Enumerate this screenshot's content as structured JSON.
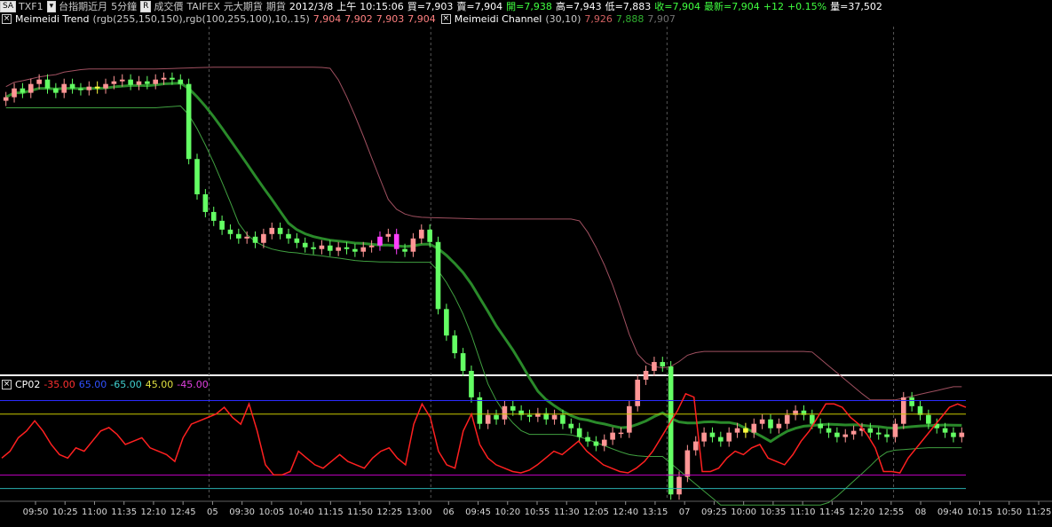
{
  "header": {
    "symbol_button": "SA",
    "symbol": "TXF1",
    "product": "台指期近月",
    "interval": "5分鐘",
    "r_button": "R",
    "price_type": "成交價",
    "exchange": "TAIFEX",
    "broker": "元大期貨",
    "market": "期貨",
    "date": "2012/3/8",
    "ampm": "上午",
    "time": "10:15:06",
    "bid": "買=7,903",
    "ask": "賣=7,904",
    "open": "開=7,938",
    "high": "高=7,943",
    "low": "低=7,883",
    "close": "收=7,904",
    "last": "最新=7,904",
    "change": "+12",
    "change_pct": "+0.15%",
    "volume": "量=37,502"
  },
  "indicator_line": {
    "trend_name": "Meimeidi Trend",
    "trend_params": "(rgb(255,150,150),rgb(100,255,100),10,.15)",
    "trend_values": [
      "7,904",
      "7,902",
      "7,903",
      "7,904"
    ],
    "channel_name": "Meimeidi Channel",
    "channel_params": "(30,10)",
    "channel_values": [
      "7,926",
      "7,888",
      "7,907"
    ]
  },
  "oscillator_header": {
    "name": "CP02",
    "levels": [
      "-35.00",
      "65.00",
      "-65.00",
      "45.00",
      "-45.00"
    ]
  },
  "colors": {
    "up": "#ff9696",
    "down": "#64ff64",
    "level_blue": "#2b2bff",
    "level_yellow": "#c8c800",
    "level_magenta": "#c000c0",
    "level_teal": "#2ab0b0",
    "osc_line": "#ff2020",
    "highlight_yellow": "#ffff40",
    "highlight_magenta": "#ff40ff"
  },
  "chart_data": {
    "type": "candlestick",
    "price_panel": {
      "ylim": [
        7700,
        8090
      ],
      "closes": [
        8010,
        8020,
        8015,
        8025,
        8030,
        8020,
        8015,
        8025,
        8020,
        8018,
        8022,
        8020,
        8025,
        8028,
        8030,
        8024,
        8028,
        8025,
        8030,
        8032,
        8030,
        8025,
        7940,
        7900,
        7880,
        7870,
        7860,
        7855,
        7850,
        7852,
        7845,
        7855,
        7862,
        7855,
        7850,
        7845,
        7840,
        7838,
        7842,
        7836,
        7840,
        7838,
        7835,
        7840,
        7842,
        7852,
        7855,
        7838,
        7835,
        7850,
        7860,
        7846,
        7770,
        7740,
        7720,
        7700,
        7670,
        7640,
        7650,
        7645,
        7660,
        7655,
        7650,
        7648,
        7652,
        7645,
        7650,
        7640,
        7635,
        7625,
        7620,
        7615,
        7622,
        7630,
        7630,
        7660,
        7690,
        7700,
        7710,
        7705,
        7560,
        7580,
        7610,
        7620,
        7630,
        7625,
        7620,
        7630,
        7635,
        7630,
        7640,
        7645,
        7635,
        7640,
        7650,
        7655,
        7650,
        7640,
        7635,
        7630,
        7625,
        7628,
        7632,
        7635,
        7630,
        7628,
        7625,
        7640,
        7670,
        7660,
        7650,
        7640,
        7635,
        7630,
        7625,
        7630
      ],
      "channel_upper_end": 7926,
      "channel_lower_end": 7888,
      "channel_mid_end": 7907
    },
    "oscillator_panel": {
      "name": "CP02",
      "ylim": [
        -80,
        80
      ],
      "levels": [
        65,
        45,
        -45,
        -65
      ],
      "values": [
        -20,
        -10,
        10,
        20,
        35,
        20,
        0,
        -15,
        -20,
        -5,
        -10,
        5,
        20,
        25,
        15,
        0,
        5,
        10,
        -5,
        -10,
        -15,
        -25,
        10,
        30,
        35,
        40,
        45,
        55,
        40,
        30,
        60,
        20,
        -30,
        -45,
        -45,
        -40,
        -10,
        -20,
        -30,
        -35,
        -25,
        -15,
        -25,
        -30,
        -35,
        -20,
        -10,
        -5,
        -20,
        -30,
        30,
        60,
        40,
        -10,
        -30,
        -35,
        20,
        45,
        0,
        -20,
        -30,
        -35,
        -40,
        -42,
        -38,
        -30,
        -20,
        -10,
        -15,
        -5,
        5,
        -10,
        -20,
        -30,
        -35,
        -40,
        -42,
        -35,
        -25,
        -10,
        10,
        30,
        50,
        75,
        70,
        -40,
        -40,
        -35,
        -20,
        -10,
        -15,
        -5,
        0,
        -20,
        -25,
        -30,
        -15,
        5,
        20,
        40,
        60,
        60,
        55,
        40,
        30,
        15,
        -5,
        -40,
        -40,
        -42,
        -20,
        -5,
        10,
        25,
        40,
        55,
        60,
        55
      ],
      "last_value": -35.0
    },
    "x_ticks": [
      "09:50",
      "10:25",
      "11:00",
      "11:35",
      "12:10",
      "12:45",
      "05",
      "09:30",
      "10:05",
      "10:40",
      "11:15",
      "11:50",
      "12:25",
      "13:00",
      "06",
      "09:45",
      "10:20",
      "10:55",
      "11:30",
      "12:05",
      "12:40",
      "13:15",
      "07",
      "09:25",
      "10:00",
      "10:35",
      "11:10",
      "11:45",
      "12:20",
      "12:55",
      "08",
      "09:40",
      "10:15",
      "10:50",
      "11:25"
    ]
  }
}
